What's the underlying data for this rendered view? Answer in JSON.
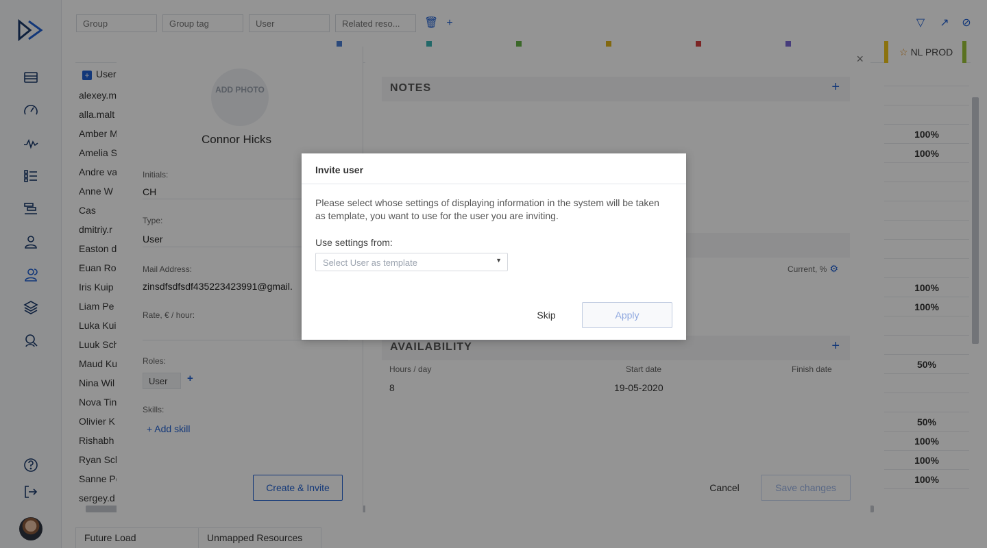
{
  "colors": {
    "accent": "#1f5fd1",
    "brand_dark": "#1a3a6b"
  },
  "sidebar": {
    "logo": "forward-logo-icon",
    "items": [
      "list-icon",
      "gauge-icon",
      "activity-icon",
      "checklist-icon",
      "timeline-icon",
      "person-icon",
      "people-icon",
      "layers-icon",
      "search-people-icon",
      "help-icon",
      "logout-icon"
    ]
  },
  "filters": {
    "group_placeholder": "Group",
    "group_tag_placeholder": "Group tag",
    "user_placeholder": "User",
    "related_placeholder": "Related reso..."
  },
  "grid": {
    "column_label": "NL PROD",
    "user_column": "User",
    "users": [
      "alexey.m",
      "alla.malt",
      "Amber M",
      "Amelia S",
      "Andre va",
      "Anne W",
      "Cas",
      "dmitriy.r",
      "Easton d",
      "Euan Ro",
      "Iris Kuip",
      "Liam Pe",
      "Luka Kui",
      "Luuk Sch",
      "Maud Ku",
      "Nina Wil",
      "Nova Tin",
      "Olivier K",
      "Rishabh",
      "Ryan Sch",
      "Sanne Po",
      "sergey.d"
    ],
    "percentages": [
      "",
      "",
      "100%",
      "100%",
      "",
      "",
      "",
      "",
      "",
      "",
      "100%",
      "100%",
      "",
      "",
      "50%",
      "",
      "",
      "50%",
      "100%",
      "100%",
      "100%",
      ""
    ]
  },
  "bottom_tabs": [
    "Future Load",
    "Unmapped Resources"
  ],
  "user_panel": {
    "add_photo": "ADD PHOTO",
    "name": "Connor Hicks",
    "initials_label": "Initials:",
    "initials_value": "CH",
    "type_label": "Type:",
    "type_value": "User",
    "mail_label": "Mail Address:",
    "mail_value": "zinsdfsdfsdf435223423991@gmail.",
    "rate_label": "Rate, € / hour:",
    "roles_label": "Roles:",
    "role_value": "User",
    "skills_label": "Skills:",
    "add_skill": "+ Add skill",
    "create_invite": "Create & Invite"
  },
  "notes_panel": {
    "notes_title": "NOTES",
    "current_label": "Current, %",
    "availability_title": "AVAILABILITY",
    "hours_head": "Hours / day",
    "start_head": "Start date",
    "finish_head": "Finish date",
    "hours_value": "8",
    "start_value": "19-05-2020",
    "cancel": "Cancel",
    "save": "Save changes"
  },
  "dialog": {
    "title": "Invite user",
    "description": "Please select whose settings of displaying information in the system will be taken as template, you want to use for the user you are inviting.",
    "settings_label": "Use settings from:",
    "select_placeholder": "Select User as template",
    "skip": "Skip",
    "apply": "Apply"
  }
}
